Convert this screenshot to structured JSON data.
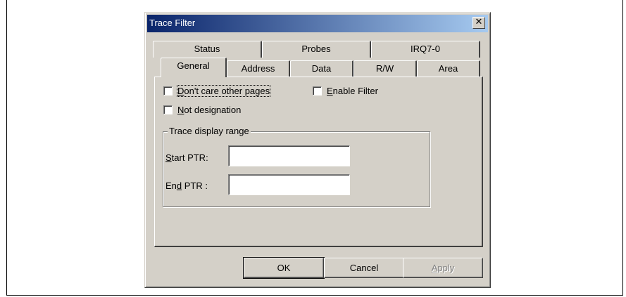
{
  "window": {
    "title": "Trace Filter",
    "close_glyph": "✕"
  },
  "tabs_back": [
    {
      "label": "Status"
    },
    {
      "label": "Probes"
    },
    {
      "label": "IRQ7-0"
    }
  ],
  "tabs_front": [
    {
      "label": "General",
      "active": true
    },
    {
      "label": "Address"
    },
    {
      "label": "Data"
    },
    {
      "label": "R/W"
    },
    {
      "label": "Area"
    }
  ],
  "options": {
    "dont_care": {
      "mnemonic": "D",
      "rest": "on't care other pages",
      "checked": false
    },
    "enable_filter": {
      "mnemonic": "E",
      "rest": "nable Filter",
      "checked": false
    },
    "not_designation": {
      "mnemonic": "N",
      "rest": "ot designation",
      "checked": false
    }
  },
  "range": {
    "legend": "Trace display range",
    "start_mn": "S",
    "start_rest": "tart PTR:",
    "start_value": "",
    "end_pre": "En",
    "end_mn": "d",
    "end_rest": " PTR :",
    "end_value": ""
  },
  "buttons": {
    "ok": "OK",
    "cancel": "Cancel",
    "apply_mn": "A",
    "apply_rest": "pply"
  },
  "colors": {
    "title_start": "#0a246a",
    "title_end": "#a6caf0",
    "face": "#d4d0c8"
  }
}
